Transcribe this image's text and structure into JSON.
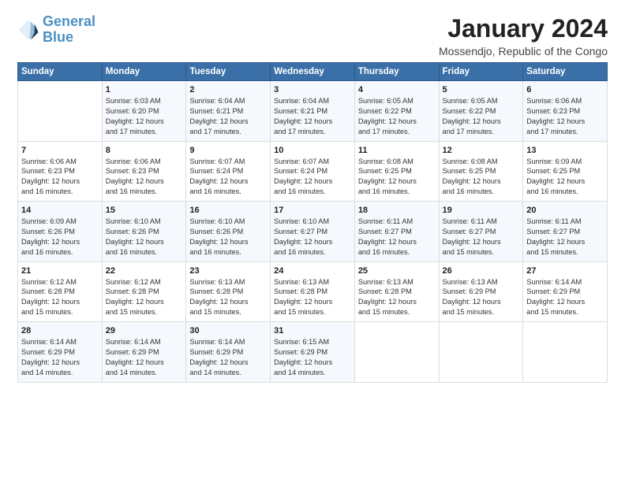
{
  "logo": {
    "line1": "General",
    "line2": "Blue"
  },
  "title": "January 2024",
  "subtitle": "Mossendjo, Republic of the Congo",
  "days_of_week": [
    "Sunday",
    "Monday",
    "Tuesday",
    "Wednesday",
    "Thursday",
    "Friday",
    "Saturday"
  ],
  "weeks": [
    [
      {
        "day": "",
        "detail": ""
      },
      {
        "day": "1",
        "detail": "Sunrise: 6:03 AM\nSunset: 6:20 PM\nDaylight: 12 hours\nand 17 minutes."
      },
      {
        "day": "2",
        "detail": "Sunrise: 6:04 AM\nSunset: 6:21 PM\nDaylight: 12 hours\nand 17 minutes."
      },
      {
        "day": "3",
        "detail": "Sunrise: 6:04 AM\nSunset: 6:21 PM\nDaylight: 12 hours\nand 17 minutes."
      },
      {
        "day": "4",
        "detail": "Sunrise: 6:05 AM\nSunset: 6:22 PM\nDaylight: 12 hours\nand 17 minutes."
      },
      {
        "day": "5",
        "detail": "Sunrise: 6:05 AM\nSunset: 6:22 PM\nDaylight: 12 hours\nand 17 minutes."
      },
      {
        "day": "6",
        "detail": "Sunrise: 6:06 AM\nSunset: 6:23 PM\nDaylight: 12 hours\nand 17 minutes."
      }
    ],
    [
      {
        "day": "7",
        "detail": "Sunrise: 6:06 AM\nSunset: 6:23 PM\nDaylight: 12 hours\nand 16 minutes."
      },
      {
        "day": "8",
        "detail": "Sunrise: 6:06 AM\nSunset: 6:23 PM\nDaylight: 12 hours\nand 16 minutes."
      },
      {
        "day": "9",
        "detail": "Sunrise: 6:07 AM\nSunset: 6:24 PM\nDaylight: 12 hours\nand 16 minutes."
      },
      {
        "day": "10",
        "detail": "Sunrise: 6:07 AM\nSunset: 6:24 PM\nDaylight: 12 hours\nand 16 minutes."
      },
      {
        "day": "11",
        "detail": "Sunrise: 6:08 AM\nSunset: 6:25 PM\nDaylight: 12 hours\nand 16 minutes."
      },
      {
        "day": "12",
        "detail": "Sunrise: 6:08 AM\nSunset: 6:25 PM\nDaylight: 12 hours\nand 16 minutes."
      },
      {
        "day": "13",
        "detail": "Sunrise: 6:09 AM\nSunset: 6:25 PM\nDaylight: 12 hours\nand 16 minutes."
      }
    ],
    [
      {
        "day": "14",
        "detail": "Sunrise: 6:09 AM\nSunset: 6:26 PM\nDaylight: 12 hours\nand 16 minutes."
      },
      {
        "day": "15",
        "detail": "Sunrise: 6:10 AM\nSunset: 6:26 PM\nDaylight: 12 hours\nand 16 minutes."
      },
      {
        "day": "16",
        "detail": "Sunrise: 6:10 AM\nSunset: 6:26 PM\nDaylight: 12 hours\nand 16 minutes."
      },
      {
        "day": "17",
        "detail": "Sunrise: 6:10 AM\nSunset: 6:27 PM\nDaylight: 12 hours\nand 16 minutes."
      },
      {
        "day": "18",
        "detail": "Sunrise: 6:11 AM\nSunset: 6:27 PM\nDaylight: 12 hours\nand 16 minutes."
      },
      {
        "day": "19",
        "detail": "Sunrise: 6:11 AM\nSunset: 6:27 PM\nDaylight: 12 hours\nand 15 minutes."
      },
      {
        "day": "20",
        "detail": "Sunrise: 6:11 AM\nSunset: 6:27 PM\nDaylight: 12 hours\nand 15 minutes."
      }
    ],
    [
      {
        "day": "21",
        "detail": "Sunrise: 6:12 AM\nSunset: 6:28 PM\nDaylight: 12 hours\nand 15 minutes."
      },
      {
        "day": "22",
        "detail": "Sunrise: 6:12 AM\nSunset: 6:28 PM\nDaylight: 12 hours\nand 15 minutes."
      },
      {
        "day": "23",
        "detail": "Sunrise: 6:13 AM\nSunset: 6:28 PM\nDaylight: 12 hours\nand 15 minutes."
      },
      {
        "day": "24",
        "detail": "Sunrise: 6:13 AM\nSunset: 6:28 PM\nDaylight: 12 hours\nand 15 minutes."
      },
      {
        "day": "25",
        "detail": "Sunrise: 6:13 AM\nSunset: 6:28 PM\nDaylight: 12 hours\nand 15 minutes."
      },
      {
        "day": "26",
        "detail": "Sunrise: 6:13 AM\nSunset: 6:29 PM\nDaylight: 12 hours\nand 15 minutes."
      },
      {
        "day": "27",
        "detail": "Sunrise: 6:14 AM\nSunset: 6:29 PM\nDaylight: 12 hours\nand 15 minutes."
      }
    ],
    [
      {
        "day": "28",
        "detail": "Sunrise: 6:14 AM\nSunset: 6:29 PM\nDaylight: 12 hours\nand 14 minutes."
      },
      {
        "day": "29",
        "detail": "Sunrise: 6:14 AM\nSunset: 6:29 PM\nDaylight: 12 hours\nand 14 minutes."
      },
      {
        "day": "30",
        "detail": "Sunrise: 6:14 AM\nSunset: 6:29 PM\nDaylight: 12 hours\nand 14 minutes."
      },
      {
        "day": "31",
        "detail": "Sunrise: 6:15 AM\nSunset: 6:29 PM\nDaylight: 12 hours\nand 14 minutes."
      },
      {
        "day": "",
        "detail": ""
      },
      {
        "day": "",
        "detail": ""
      },
      {
        "day": "",
        "detail": ""
      }
    ]
  ]
}
